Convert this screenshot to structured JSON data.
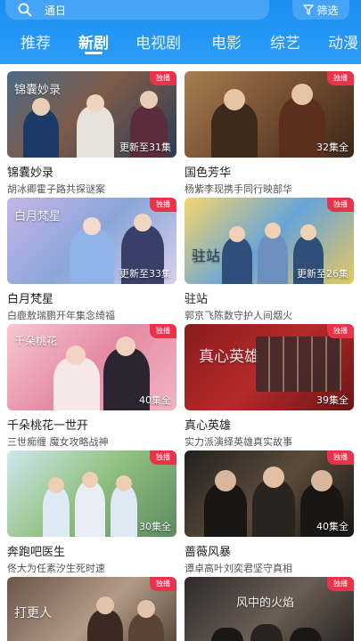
{
  "search": {
    "placeholder": "通日"
  },
  "filter": {
    "label": "筛选"
  },
  "tabs": [
    "推荐",
    "新剧",
    "电视剧",
    "电影",
    "综艺",
    "动漫"
  ],
  "badge": "独播",
  "cards": [
    {
      "name": "锦囊妙录",
      "desc": "胡冰卿霍子路共探谜案",
      "ep": "更新至31集",
      "art": "锦囊妙录"
    },
    {
      "name": "国色芳华",
      "desc": "杨紫李现携手同行映部华",
      "ep": "32集全",
      "art": ""
    },
    {
      "name": "白月梵星",
      "desc": "白鹿敖瑞鹏开年集念绮福",
      "ep": "更新至33集",
      "art": "白月梵星"
    },
    {
      "name": "驻站",
      "desc": "郭京飞陈数守护人间烟火",
      "ep": "更新至26集",
      "art": "驻站"
    },
    {
      "name": "千朵桃花一世开",
      "desc": "三世痴缠 魔女攻略战神",
      "ep": "40集全",
      "art": "千朵桃花"
    },
    {
      "name": "真心英雄",
      "desc": "实力派演绎英雄真实故事",
      "ep": "39集全",
      "art": "真心英雄"
    },
    {
      "name": "奔跑吧医生",
      "desc": "佟大为任素汐生死时速",
      "ep": "30集全",
      "art": ""
    },
    {
      "name": "蔷薇风暴",
      "desc": "谭卓高叶刘奕君坚守真相",
      "ep": "40集全",
      "art": ""
    },
    {
      "name": "",
      "desc": "",
      "ep": "",
      "art": "打更人"
    },
    {
      "name": "",
      "desc": "",
      "ep": "",
      "art": "风中的火焰"
    }
  ],
  "colors": {
    "header": "#1c8ff3",
    "badge": "#e8334a"
  }
}
